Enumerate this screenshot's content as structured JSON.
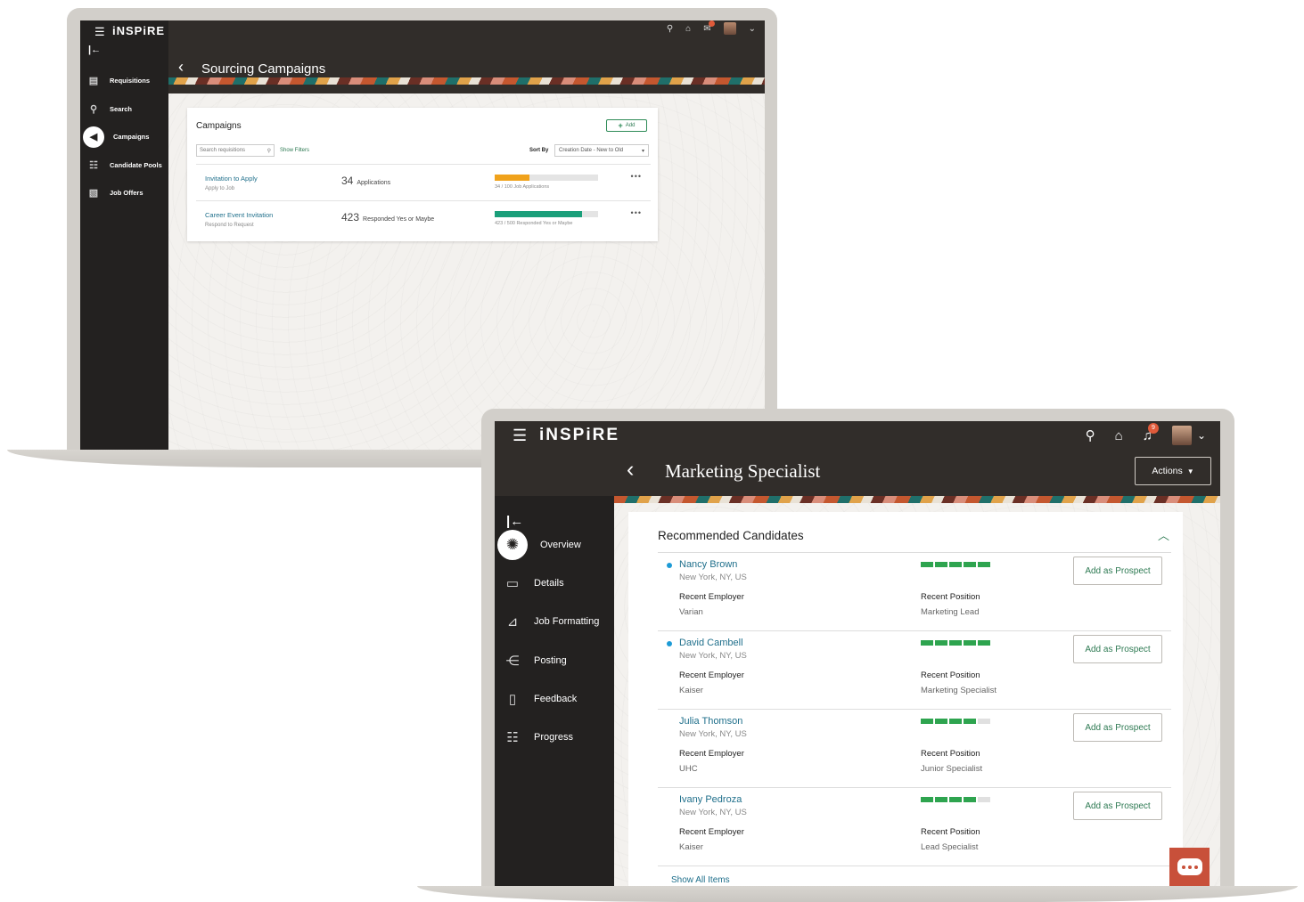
{
  "back_window": {
    "brand": "iNSPiRE",
    "page_title": "Sourcing Campaigns",
    "nav": [
      {
        "label": "Requisitions",
        "icon": "document-list-icon"
      },
      {
        "label": "Search",
        "icon": "search-icon"
      },
      {
        "label": "Campaigns",
        "icon": "megaphone-icon",
        "active": true
      },
      {
        "label": "Candidate Pools",
        "icon": "people-group-icon"
      },
      {
        "label": "Job Offers",
        "icon": "job-offer-icon"
      }
    ],
    "card": {
      "title": "Campaigns",
      "add_label": "Add",
      "search_placeholder": "Search requisitions",
      "show_filters": "Show Filters",
      "sort_label": "Sort By",
      "sort_value": "Creation Date - New to Old",
      "rows": [
        {
          "name": "Invitation to Apply",
          "sub": "Apply to Job",
          "count": "34",
          "count_unit": "Applications",
          "progress": 0.34,
          "progress_color": "#f0a21b",
          "progress_label": "34 / 100 Job Applications"
        },
        {
          "name": "Career Event Invitation",
          "sub": "Respond to Request",
          "count": "423",
          "count_unit": "Responded Yes or Maybe",
          "progress": 0.846,
          "progress_color": "#1a9f7a",
          "progress_label": "423 / 500 Responded Yes or Maybe"
        }
      ]
    }
  },
  "front_window": {
    "brand": "iNSPiRE",
    "notification_count": "9",
    "page_title": "Marketing Specialist",
    "actions_label": "Actions",
    "nav": [
      {
        "label": "Overview",
        "icon": "overview-icon",
        "active": true
      },
      {
        "label": "Details",
        "icon": "details-icon"
      },
      {
        "label": "Job Formatting",
        "icon": "job-formatting-icon"
      },
      {
        "label": "Posting",
        "icon": "posting-icon"
      },
      {
        "label": "Feedback",
        "icon": "feedback-icon"
      },
      {
        "label": "Progress",
        "icon": "progress-icon"
      }
    ],
    "section_title": "Recommended Candidates",
    "employer_label": "Recent Employer",
    "position_label": "Recent Position",
    "prospect_label": "Add as Prospect",
    "candidates": [
      {
        "name": "Nancy Brown",
        "location": "New York, NY, US",
        "employer": "Varian",
        "position": "Marketing Lead",
        "rating": 5,
        "new": true
      },
      {
        "name": "David Cambell",
        "location": "New York, NY, US",
        "employer": "Kaiser",
        "position": "Marketing Specialist",
        "rating": 5,
        "new": true
      },
      {
        "name": "Julia Thomson",
        "location": "New York, NY, US",
        "employer": "UHC",
        "position": "Junior Specialist",
        "rating": 4,
        "new": false
      },
      {
        "name": "Ivany Pedroza",
        "location": "New York, NY, US",
        "employer": "Kaiser",
        "position": "Lead Specialist",
        "rating": 4,
        "new": false
      }
    ],
    "show_all": "Show All Items"
  }
}
